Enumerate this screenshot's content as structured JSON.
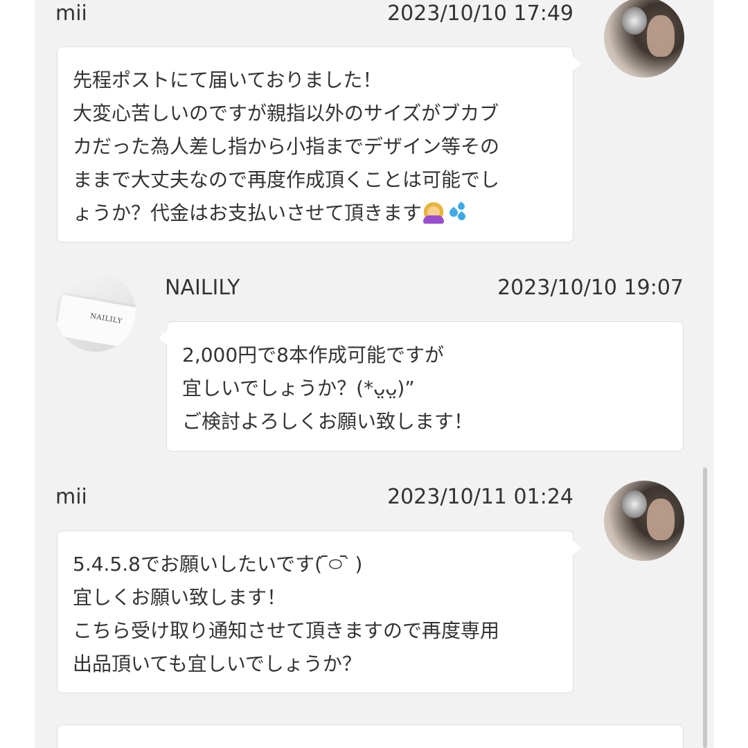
{
  "messages": [
    {
      "sender": "mii",
      "timestamp": "2023/10/10 17:49",
      "side": "right",
      "avatar": "user-photo",
      "lines": [
        "先程ポストにて届いておりました！",
        "大変心苦しいのですが親指以外のサイズがブカブ",
        "カだった為人差し指から小指までデザイン等その",
        "ままで大丈夫なので再度作成頂くことは可能でし",
        "ょうか？代金はお支払いさせて頂きます"
      ],
      "trailing_emoji": [
        "woman-bowing-emoji",
        "sweat-droplets-emoji"
      ]
    },
    {
      "sender": "NAILILY",
      "timestamp": "2023/10/10 19:07",
      "side": "left",
      "avatar": "brand-logo",
      "avatar_text": "NAILILY",
      "lines": [
        "2,000円で8本作成可能ですが",
        "宜しいでしょうか？(*ᴗ̤ᴗ̤)”",
        "ご検討よろしくお願い致します！"
      ]
    },
    {
      "sender": "mii",
      "timestamp": "2023/10/11 01:24",
      "side": "right",
      "avatar": "user-photo",
      "lines": [
        "5.4.5.8でお願いしたいです( ᷇࿀ ᷆ )",
        "宜しくお願い致します！",
        "こちら受け取り通知させて頂きますので再度専用",
        "出品頂いても宜しいでしょうか？"
      ]
    }
  ],
  "colors": {
    "thread_background": "#f2f2f2",
    "bubble_background": "#ffffff",
    "bubble_border": "#dedede",
    "text": "#333333"
  }
}
